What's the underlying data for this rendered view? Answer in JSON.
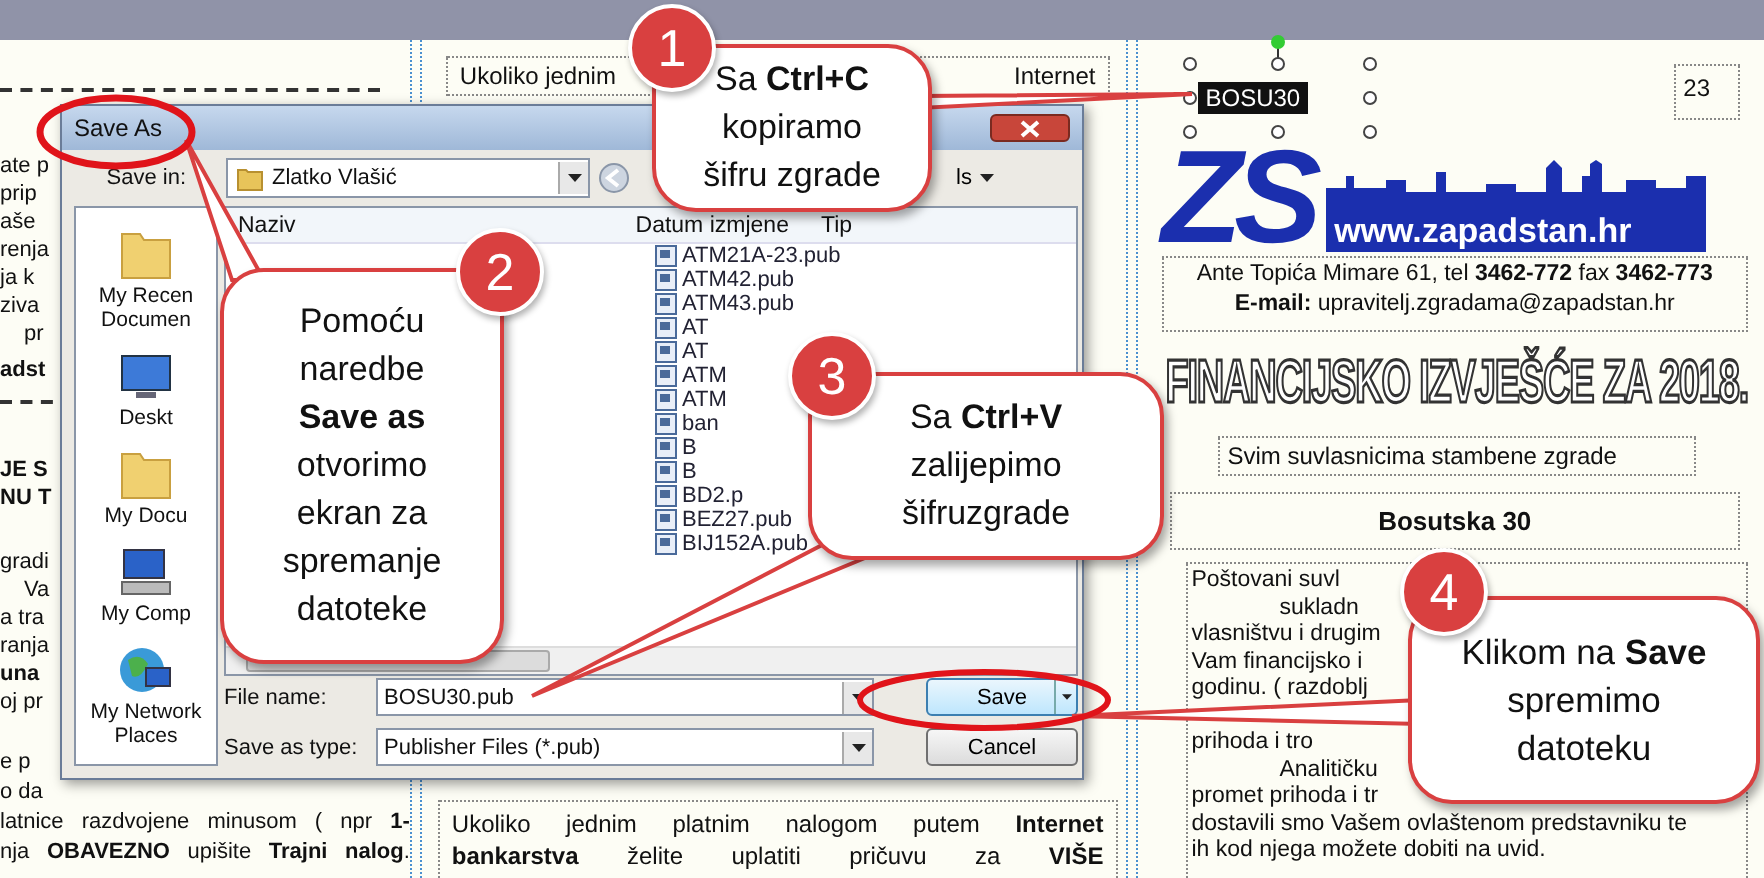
{
  "column_1": {
    "groups": [
      {
        "lines": [
          {
            "text": "ate p",
            "kind": "plain"
          },
          {
            "text": "prip",
            "kind": "plain"
          },
          {
            "text": "aše",
            "kind": "plain"
          },
          {
            "text": "renja",
            "kind": "plain"
          },
          {
            "text": "ja k",
            "kind": "plain"
          },
          {
            "text": "ziva",
            "kind": "plain"
          },
          {
            "text": "pr",
            "kind": "indent"
          }
        ]
      },
      {
        "lines": [
          {
            "text": "adst",
            "kind": "bold"
          }
        ]
      },
      {
        "lines": [
          {
            "text": "JE S",
            "kind": "bold"
          },
          {
            "text": "NU T",
            "kind": "bold"
          }
        ]
      },
      {
        "lines": [
          {
            "text": "gradi",
            "kind": "plain"
          },
          {
            "text": "Va",
            "kind": "indent"
          },
          {
            "text": "a tra",
            "kind": "plain"
          },
          {
            "text": "ranja",
            "kind": "plain"
          },
          {
            "text": "una",
            "kind": "bold"
          },
          {
            "text": "oj pr",
            "kind": "plain"
          }
        ]
      },
      {
        "lines": [
          {
            "text": "e p",
            "kind": "plain"
          },
          {
            "text": "o da",
            "kind": "plain"
          },
          {
            "text": "latnice razdvojene minusom ( npr **1-**",
            "kind": "justify"
          },
          {
            "text": "nja **OBAVEZNO** upišite **Trajni nalog**.",
            "kind": "justify"
          }
        ]
      }
    ]
  },
  "column_2": {
    "top_box": {
      "left": "Ukoliko jednim",
      "right": "Internet"
    },
    "bottom_box": {
      "lines": [
        "Ukoliko jednim platnim nalogom putem **Internet**",
        "**bankarstva** želite uplatiti pričuvu za **VIŠE**"
      ]
    }
  },
  "column_3": {
    "selected_text": "BOSU30",
    "page_number": "23",
    "logo": {
      "letters": "ZS",
      "url": "www.zapadstan.hr"
    },
    "address": [
      "Ante Topića Mimare 61, tel **3462-772** fax **3462-773**",
      "**E-mail:** upravitelj.zgradama@zapadstan.hr"
    ],
    "title": "FINANCIJSKO IZVJEŠĆE ZA 2018.",
    "subtitle": "Svim suvlasnicima stambene zgrade",
    "building": "Bosutska 30",
    "letter": [
      {
        "text": "Poštovani  suvl",
        "kind": "plain"
      },
      {
        "text": "sukladn",
        "kind": "indent"
      },
      {
        "text": "vlasništvu i drugim",
        "kind": "plain"
      },
      {
        "text": "Vam financijsko i",
        "kind": "plain"
      },
      {
        "text": "godinu. ( razdoblj",
        "kind": "plain"
      },
      {
        "text": "prihoda i tro",
        "kind": "plain"
      },
      {
        "text": "Analitičku",
        "kind": "indent"
      },
      {
        "text": "promet prihoda i tr",
        "kind": "plain"
      },
      {
        "text": "dostavili smo Vašem ovlaštenom predstavniku te",
        "kind": "plain"
      },
      {
        "text": "ih kod njega možete dobiti na uvid.",
        "kind": "plain"
      }
    ]
  },
  "dialog": {
    "title": "Save As",
    "save_in_label": "Save in:",
    "folder": "Zlatko Vlašić",
    "toolbar_fragment": "ls",
    "places": [
      {
        "label": "My Recen Documen",
        "kind": "recent"
      },
      {
        "label": "Deskt",
        "kind": "desktop"
      },
      {
        "label": "My Docu",
        "kind": "documents"
      },
      {
        "label": "My Comp",
        "kind": "computer"
      },
      {
        "label": "My Network Places",
        "kind": "network"
      }
    ],
    "columns": [
      "Naziv",
      "Datum izmjene",
      "Tip"
    ],
    "files": [
      "ATM21A-23.pub",
      "ATM42.pub",
      "ATM43.pub",
      "AT",
      "AT",
      "ATM",
      "ATM",
      "ban",
      "B",
      "B",
      "BD2.p",
      "BEZ27.pub",
      "BIJ152A.pub"
    ],
    "file_name": {
      "label": "File name:",
      "value": "BOSU30.pub"
    },
    "file_type": {
      "label": "Save as type:",
      "value": "Publisher Files (*.pub)"
    },
    "buttons": [
      {
        "label": "Save",
        "kind": "primary"
      },
      {
        "label": "Cancel",
        "kind": "secondary"
      }
    ]
  },
  "callouts": [
    {
      "number": "1",
      "lines": [
        "Sa **Ctrl+C**",
        "kopiramo",
        "šifru zgrade"
      ]
    },
    {
      "number": "2",
      "lines": [
        "Pomoću",
        "naredbe",
        "**Save as**",
        "otvorimo",
        "ekran za",
        "spremanje",
        "datoteke"
      ]
    },
    {
      "number": "3",
      "lines": [
        "Sa **Ctrl+V**",
        "zalijepimo",
        "šifruzgrade"
      ]
    },
    {
      "number": "4",
      "lines": [
        "Klikom na **Save**",
        "spremimo",
        "datoteku"
      ]
    }
  ]
}
